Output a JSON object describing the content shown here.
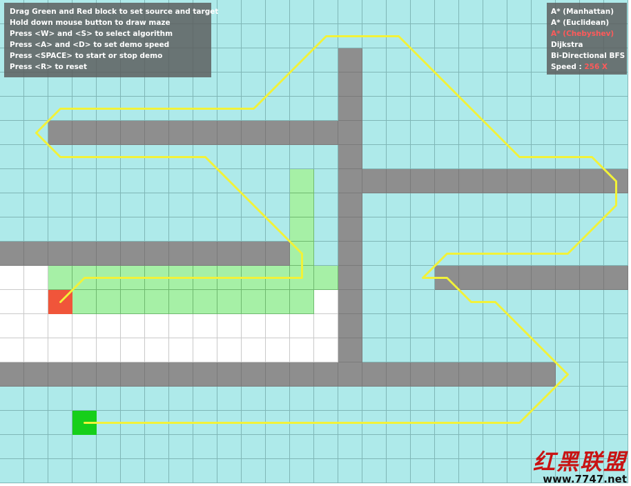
{
  "instructions": [
    "Drag Green and Red block to set source and target",
    "Hold down mouse button to draw maze",
    "Press <W> and <S> to select algorithm",
    "Press <A> and <D> to set demo speed",
    "Press <SPACE> to start or stop demo",
    "Press <R> to reset"
  ],
  "algorithms": [
    {
      "label": "A* (Manhattan)",
      "active": false
    },
    {
      "label": "A* (Euclidean)",
      "active": false
    },
    {
      "label": "A* (Chebyshev)",
      "active": true
    },
    {
      "label": "Dijkstra",
      "active": false
    },
    {
      "label": "Bi-Directional BFS",
      "active": false
    }
  ],
  "speed": {
    "label": "Speed :",
    "value": "256 X"
  },
  "colors": {
    "open": "#aeeaea",
    "closed": "#a6f0a6",
    "wall": "#8e8e8e",
    "empty": "#ffffff",
    "source": "#f0553a",
    "target": "#16cf1a",
    "path": "#f2f238",
    "active_algorithm": "#ff5a5a"
  },
  "grid": {
    "cols": 26,
    "rows": 20,
    "map": [
      "OOOOOOOOOOOOOOOOOOOOOOOOOO",
      "OOOOOOOOOOOOOOOOOOOOOOOOOO",
      "OOOOOOOOOOOOOOWOOOOOOOOOOO",
      "OOOOOOOOOOOOOOWOOOOOOOOOOO",
      "OOOOOOOOOOOOOOWOOOOOOOOOOO",
      "OOWWWWWWWWWWWWWOOOOOOOOOOO",
      "OOOOOOOOOOOOOOWOOOOOOOOOOO",
      "OOOOOOOOOOOOCOWWWWWWWWWWWW",
      "OOOOOOOOOOOOCOWOOOOOOOOOOO",
      "OOOOOOOOOOOOCOWOOOOOOOOOOO",
      "WWWWWWWWWWWWCOWOOOOOOOOOOO",
      "EECCCCCCCCCCCCWOOOWWWWWWWW",
      "EECCCCCCCCCCCEWOOOOOOOOOOO",
      "EEEEEEEEEEEEEEWOOOOOOOOOOO",
      "EEEEEEEEEEEEEEWOOOOOOOOOOO",
      "WWWWWWWWWWWWWWWWWWWWWWWOOO",
      "OOOOOOOOOOOOOOOOOOOOOOOOOO",
      "OOOOOOOOOOOOOOOOOOOOOOOOOO",
      "OOOOOOOOOOOOOOOOOOOOOOOOOO",
      "OOOOOOOOOOOOOOOOOOOOOOOOOO"
    ],
    "source": {
      "col": 2,
      "row": 12
    },
    "target": {
      "col": 3,
      "row": 17
    },
    "path": [
      [
        3,
        17
      ],
      [
        4,
        17
      ],
      [
        5,
        17
      ],
      [
        6,
        17
      ],
      [
        7,
        17
      ],
      [
        8,
        17
      ],
      [
        9,
        17
      ],
      [
        10,
        17
      ],
      [
        11,
        17
      ],
      [
        12,
        17
      ],
      [
        13,
        17
      ],
      [
        14,
        17
      ],
      [
        15,
        17
      ],
      [
        16,
        17
      ],
      [
        17,
        17
      ],
      [
        18,
        17
      ],
      [
        19,
        17
      ],
      [
        20,
        17
      ],
      [
        21,
        17
      ],
      [
        22,
        16
      ],
      [
        23,
        15
      ],
      [
        22,
        14
      ],
      [
        21,
        13
      ],
      [
        20,
        12
      ],
      [
        19,
        12
      ],
      [
        18,
        11
      ],
      [
        17,
        11
      ],
      [
        18,
        10
      ],
      [
        19,
        10
      ],
      [
        20,
        10
      ],
      [
        21,
        10
      ],
      [
        22,
        10
      ],
      [
        23,
        10
      ],
      [
        24,
        9
      ],
      [
        25,
        8
      ],
      [
        25,
        7
      ],
      [
        24,
        6
      ],
      [
        23,
        6
      ],
      [
        22,
        6
      ],
      [
        21,
        6
      ],
      [
        20,
        5
      ],
      [
        19,
        4
      ],
      [
        18,
        3
      ],
      [
        17,
        2
      ],
      [
        16,
        1
      ],
      [
        15,
        1
      ],
      [
        14,
        1
      ],
      [
        13,
        1
      ],
      [
        12,
        2
      ],
      [
        11,
        3
      ],
      [
        10,
        4
      ],
      [
        9,
        4
      ],
      [
        8,
        4
      ],
      [
        7,
        4
      ],
      [
        6,
        4
      ],
      [
        5,
        4
      ],
      [
        4,
        4
      ],
      [
        3,
        4
      ],
      [
        2,
        4
      ],
      [
        1,
        5
      ],
      [
        2,
        6
      ],
      [
        3,
        6
      ],
      [
        4,
        6
      ],
      [
        5,
        6
      ],
      [
        6,
        6
      ],
      [
        7,
        6
      ],
      [
        8,
        6
      ],
      [
        9,
        7
      ],
      [
        10,
        8
      ],
      [
        11,
        9
      ],
      [
        12,
        10
      ],
      [
        12,
        11
      ],
      [
        11,
        11
      ],
      [
        10,
        11
      ],
      [
        9,
        11
      ],
      [
        8,
        11
      ],
      [
        7,
        11
      ],
      [
        6,
        11
      ],
      [
        5,
        11
      ],
      [
        4,
        11
      ],
      [
        3,
        11
      ],
      [
        2,
        12
      ]
    ]
  }
}
